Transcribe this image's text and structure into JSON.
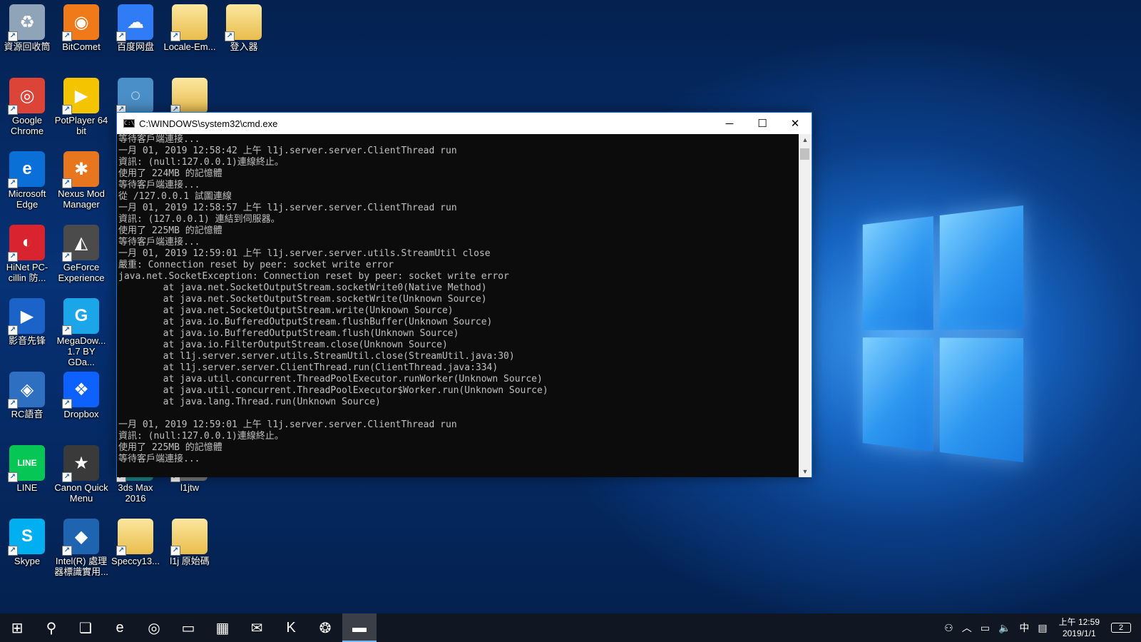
{
  "desktop_icons": [
    {
      "label": "資源回收筒",
      "icon": "recycle-bin-icon",
      "glyph": "♻",
      "color": "#8fa4b8",
      "col": 0,
      "row": 0
    },
    {
      "label": "BitComet",
      "icon": "bitcomet-icon",
      "glyph": "◉",
      "color": "#f07a1a",
      "col": 1,
      "row": 0
    },
    {
      "label": "百度网盘",
      "icon": "baidu-netdisk-icon",
      "glyph": "☁",
      "color": "#2f7cf6",
      "col": 2,
      "row": 0
    },
    {
      "label": "Locale-Em...",
      "icon": "folder-icon",
      "glyph": "",
      "color": "#e9bd4c",
      "col": 3,
      "row": 0
    },
    {
      "label": "登入器",
      "icon": "folder-icon",
      "glyph": "",
      "color": "#e9bd4c",
      "col": 4,
      "row": 0
    },
    {
      "label": "Google Chrome",
      "icon": "chrome-icon",
      "glyph": "◎",
      "color": "#db4437",
      "col": 0,
      "row": 1
    },
    {
      "label": "PotPlayer 64 bit",
      "icon": "potplayer-icon",
      "glyph": "▶",
      "color": "#f5c400",
      "col": 1,
      "row": 1
    },
    {
      "label": "",
      "icon": "app-icon",
      "glyph": "◌",
      "color": "#4a8fc7",
      "col": 2,
      "row": 1
    },
    {
      "label": "",
      "icon": "folder-icon",
      "glyph": "",
      "color": "#e9bd4c",
      "col": 3,
      "row": 1
    },
    {
      "label": "Microsoft Edge",
      "icon": "edge-icon",
      "glyph": "e",
      "color": "#0a6fd6",
      "col": 0,
      "row": 2
    },
    {
      "label": "Nexus Mod Manager",
      "icon": "nexus-mod-manager-icon",
      "glyph": "✱",
      "color": "#e8761e",
      "col": 1,
      "row": 2
    },
    {
      "label": "HiNet PC-cillin 防...",
      "icon": "pc-cillin-icon",
      "glyph": "◐",
      "color": "#d9232e",
      "col": 0,
      "row": 3
    },
    {
      "label": "GeForce Experience",
      "icon": "geforce-icon",
      "glyph": "◭",
      "color": "#4b4b4b",
      "col": 1,
      "row": 3
    },
    {
      "label": "影音先锋",
      "icon": "xfplay-icon",
      "glyph": "▶",
      "color": "#1b63c8",
      "col": 0,
      "row": 4
    },
    {
      "label": "MegaDow... 1.7 BY GDa...",
      "icon": "megadownloader-icon",
      "glyph": "G",
      "color": "#1aa6e8",
      "col": 1,
      "row": 4
    },
    {
      "label": "RC語音",
      "icon": "rc-voice-icon",
      "glyph": "◈",
      "color": "#2e6fc2",
      "col": 0,
      "row": 5
    },
    {
      "label": "Dropbox",
      "icon": "dropbox-icon",
      "glyph": "❖",
      "color": "#0d62ff",
      "col": 1,
      "row": 5
    },
    {
      "label": "LINE",
      "icon": "line-icon",
      "glyph": "LINE",
      "color": "#06c755",
      "col": 0,
      "row": 6
    },
    {
      "label": "Canon Quick Menu",
      "icon": "canon-quick-menu-icon",
      "glyph": "★",
      "color": "#3a3a3a",
      "col": 1,
      "row": 6
    },
    {
      "label": "3ds Max 2016",
      "icon": "3ds-max-icon",
      "glyph": "",
      "color": "#1a8a8a",
      "col": 2,
      "row": 6
    },
    {
      "label": "l1jtw",
      "icon": "l1jtw-icon",
      "glyph": "",
      "color": "#7a7a7a",
      "col": 3,
      "row": 6
    },
    {
      "label": "Skype",
      "icon": "skype-icon",
      "glyph": "S",
      "color": "#00aff0",
      "col": 0,
      "row": 7
    },
    {
      "label": "Intel(R) 處理器標識實用...",
      "icon": "intel-processor-id-icon",
      "glyph": "◆",
      "color": "#1f64b0",
      "col": 1,
      "row": 7
    },
    {
      "label": "Speccy13...",
      "icon": "folder-icon",
      "glyph": "",
      "color": "#e9bd4c",
      "col": 2,
      "row": 7
    },
    {
      "label": "l1j 原始碼",
      "icon": "folder-icon",
      "glyph": "",
      "color": "#e9bd4c",
      "col": 3,
      "row": 7
    }
  ],
  "cmd_window": {
    "title": "C:\\WINDOWS\\system32\\cmd.exe",
    "minimize": "─",
    "maximize": "☐",
    "close": "✕",
    "lines": [
      "等待客戶端連接...",
      "一月 01, 2019 12:58:42 上午 l1j.server.server.ClientThread run",
      "資訊: (null:127.0.0.1)連線終止。",
      "使用了 224MB 的記憶體",
      "等待客戶端連接...",
      "從 /127.0.0.1 試圖連線",
      "一月 01, 2019 12:58:57 上午 l1j.server.server.ClientThread run",
      "資訊: (127.0.0.1) 連結到伺服器。",
      "使用了 225MB 的記憶體",
      "等待客戶端連接...",
      "一月 01, 2019 12:59:01 上午 l1j.server.server.utils.StreamUtil close",
      "嚴重: Connection reset by peer: socket write error",
      "java.net.SocketException: Connection reset by peer: socket write error",
      "        at java.net.SocketOutputStream.socketWrite0(Native Method)",
      "        at java.net.SocketOutputStream.socketWrite(Unknown Source)",
      "        at java.net.SocketOutputStream.write(Unknown Source)",
      "        at java.io.BufferedOutputStream.flushBuffer(Unknown Source)",
      "        at java.io.BufferedOutputStream.flush(Unknown Source)",
      "        at java.io.FilterOutputStream.close(Unknown Source)",
      "        at l1j.server.server.utils.StreamUtil.close(StreamUtil.java:30)",
      "        at l1j.server.server.ClientThread.run(ClientThread.java:334)",
      "        at java.util.concurrent.ThreadPoolExecutor.runWorker(Unknown Source)",
      "        at java.util.concurrent.ThreadPoolExecutor$Worker.run(Unknown Source)",
      "        at java.lang.Thread.run(Unknown Source)",
      "",
      "一月 01, 2019 12:59:01 上午 l1j.server.server.ClientThread run",
      "資訊: (null:127.0.0.1)連線終止。",
      "使用了 225MB 的記憶體",
      "等待客戶端連接..."
    ]
  },
  "taskbar": {
    "start": "⊞",
    "items": [
      {
        "name": "search-icon",
        "glyph": "⚲",
        "active": false
      },
      {
        "name": "task-view-icon",
        "glyph": "❏",
        "active": false
      },
      {
        "name": "edge-taskbar-icon",
        "glyph": "e",
        "active": false
      },
      {
        "name": "chrome-taskbar-icon",
        "glyph": "◎",
        "active": false
      },
      {
        "name": "file-explorer-icon",
        "glyph": "▭",
        "active": false
      },
      {
        "name": "store-icon",
        "glyph": "▦",
        "active": false
      },
      {
        "name": "mail-icon",
        "glyph": "✉",
        "active": false
      },
      {
        "name": "kaspersky-icon",
        "glyph": "K",
        "active": false
      },
      {
        "name": "app-taskbar-icon",
        "glyph": "❂",
        "active": false
      },
      {
        "name": "cmd-taskbar-icon",
        "glyph": "▬",
        "active": true
      }
    ],
    "tray": {
      "people": "⚇",
      "chevron": "︿",
      "network": "▭",
      "volume": "🔈",
      "ime": "中",
      "action": "▤",
      "time": "上午 12:59",
      "date": "2019/1/1",
      "notifications": "2"
    }
  }
}
